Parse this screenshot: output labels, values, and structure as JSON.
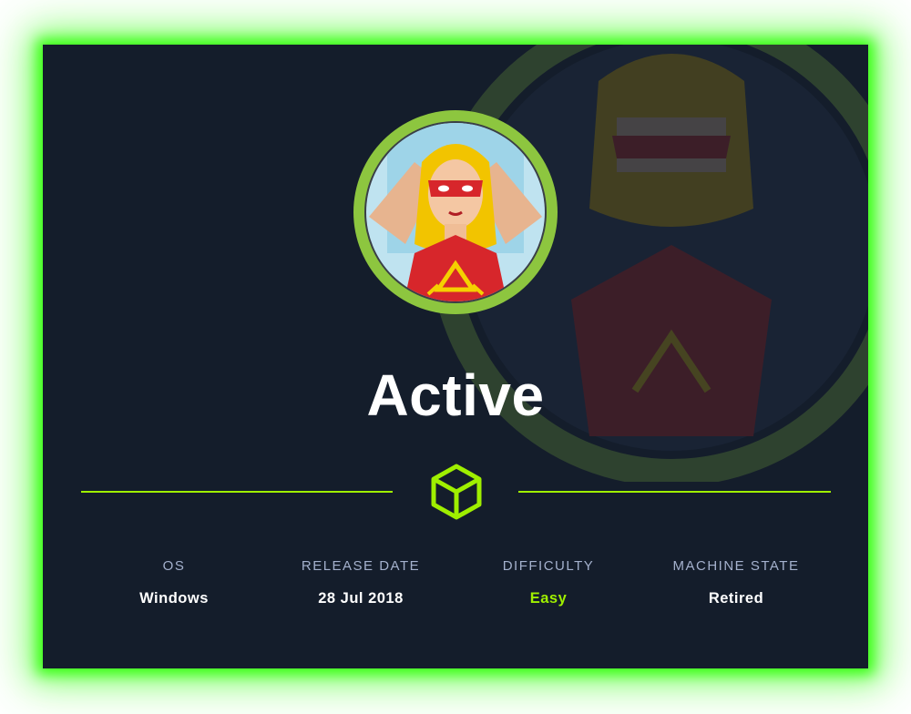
{
  "machine": {
    "name": "Active",
    "avatar_icon": "superhero-avatar-icon",
    "divider_icon": "box-cube-icon"
  },
  "stats": [
    {
      "label": "OS",
      "value": "Windows"
    },
    {
      "label": "RELEASE DATE",
      "value": "28 Jul 2018"
    },
    {
      "label": "DIFFICULTY",
      "value": "Easy"
    },
    {
      "label": "MACHINE STATE",
      "value": "Retired"
    }
  ],
  "colors": {
    "background": "#141d2b",
    "accent": "#9fef00",
    "glow": "#39ff14",
    "label": "#a4b1cd",
    "value": "#ffffff"
  }
}
